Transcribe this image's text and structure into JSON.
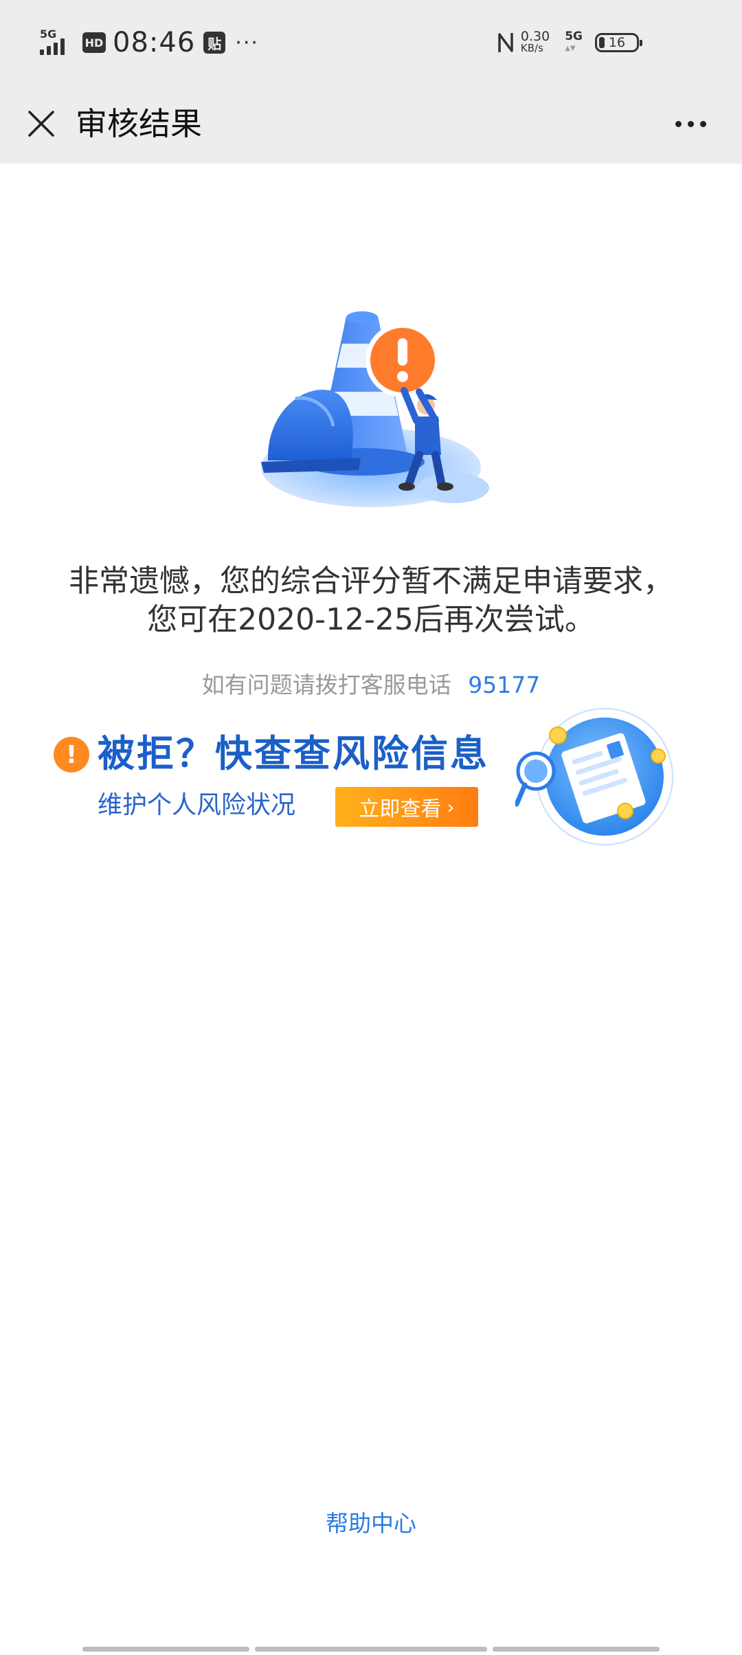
{
  "status_bar": {
    "network_tag": "5G",
    "hd_badge": "HD",
    "time": "08:46",
    "tie_badge": "贴",
    "more": "···",
    "speed_value": "0.30",
    "speed_unit": "KB/s",
    "network_right": "5G",
    "battery": "16"
  },
  "nav": {
    "title": "审核结果"
  },
  "result": {
    "message": "非常遗憾，您的综合评分暂不满足申请要求，您可在2020-12-25后再次尝试。",
    "hotline_label": "如有问题请拨打客服电话",
    "hotline_number": "95177"
  },
  "banner": {
    "title": "被拒？快查查风险信息",
    "subtitle": "维护个人风险状况",
    "button_label": "立即查看",
    "button_chevron": "›",
    "warning_glyph": "!"
  },
  "footer": {
    "help_label": "帮助中心"
  },
  "colors": {
    "accent": "#2b7be5",
    "banner_title": "#1b5fc9",
    "orange": "#ff8a1f",
    "header_bg": "#ededed"
  }
}
